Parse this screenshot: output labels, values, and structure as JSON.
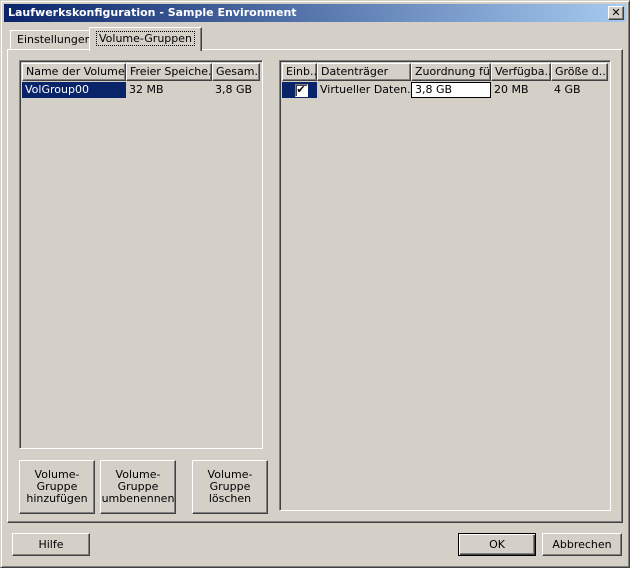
{
  "window": {
    "title": "Laufwerkskonfiguration - Sample Environment",
    "close_glyph": "✕"
  },
  "tabs": [
    {
      "label": "Einstellungen",
      "active": false
    },
    {
      "label": "Volume-Gruppen",
      "active": true
    }
  ],
  "volume_groups": {
    "columns": [
      "Name der Volume...",
      "Freier Speiche...",
      "Gesam..."
    ],
    "rows": [
      {
        "name": "VolGroup00",
        "free": "32 MB",
        "total": "3,8 GB",
        "selected": true
      }
    ]
  },
  "disks": {
    "columns": [
      "Einb...",
      "Datenträger",
      "Zuordnung fü...",
      "Verfügba...",
      "Größe d..."
    ],
    "rows": [
      {
        "included": true,
        "check_glyph": "✔",
        "disk": "Virtueller Daten...",
        "allocation": "3,8 GB",
        "available": "20 MB",
        "size": "4 GB"
      }
    ]
  },
  "buttons": {
    "add_group": "Volume-\nGruppe\nhinzufügen",
    "rename_group": "Volume-\nGruppe\numbenennen",
    "delete_group": "Volume-\nGruppe\nlöschen",
    "help": "Hilfe",
    "ok": "OK",
    "cancel": "Abbrechen"
  },
  "colors": {
    "selection": "#0a246a",
    "face": "#d4d0c8"
  }
}
